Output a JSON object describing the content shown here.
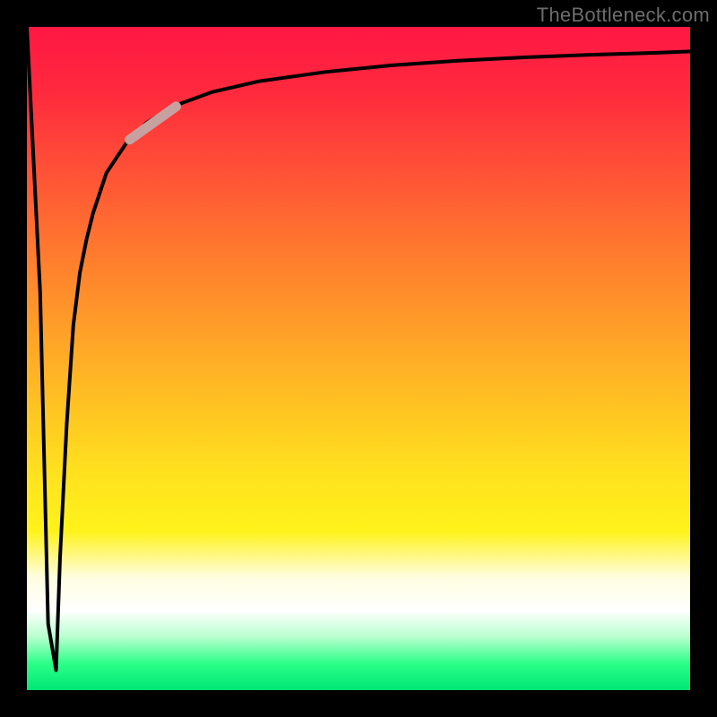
{
  "watermark": "TheBottleneck.com",
  "colors": {
    "frame": "#000000",
    "gradient_top": "#ff1744",
    "gradient_mid": "#ffe31e",
    "gradient_white": "#ffffff",
    "gradient_bottom": "#00e676",
    "curve": "#000000",
    "highlight": "#c7a0a0"
  },
  "chart_data": {
    "type": "line",
    "title": "",
    "xlabel": "",
    "ylabel": "",
    "xlim": [
      0,
      100
    ],
    "ylim": [
      0,
      100
    ],
    "annotations": [
      {
        "text": "TheBottleneck.com",
        "position": "top-right"
      }
    ],
    "series": [
      {
        "name": "bottleneck-curve",
        "x": [
          0,
          2.0,
          3.2,
          4.4,
          5,
          6,
          7,
          8,
          9,
          10,
          12,
          15,
          18,
          22,
          28,
          35,
          45,
          55,
          65,
          75,
          85,
          95,
          100
        ],
        "y": [
          100,
          60,
          10,
          3,
          20,
          40,
          55,
          63,
          68,
          72,
          78,
          82.5,
          85.5,
          88,
          90.2,
          91.8,
          93.2,
          94.2,
          94.9,
          95.4,
          95.8,
          96.1,
          96.3
        ]
      },
      {
        "name": "highlight-segment",
        "x": [
          15.5,
          22.5
        ],
        "y": [
          83,
          88
        ]
      }
    ]
  }
}
